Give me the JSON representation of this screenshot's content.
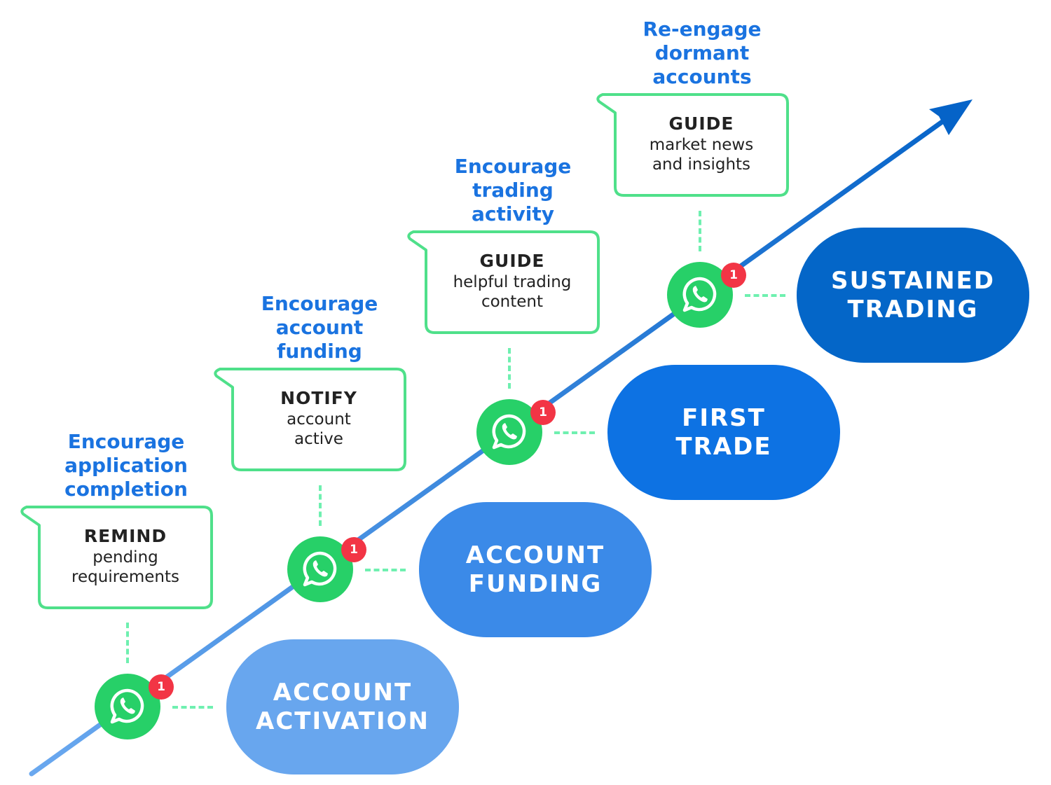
{
  "colors": {
    "goal_text": "#1a73e0",
    "bubble_border": "#4fe08a",
    "connector": "#6ff0b0",
    "whatsapp_green": "#27d068",
    "badge_red": "#f23545",
    "arrow_start": "#6aa8ef",
    "arrow_end": "#0563c8"
  },
  "steps": [
    {
      "goal": [
        "Encourage",
        "application",
        "completion"
      ],
      "action": "REMIND",
      "detail": [
        "pending",
        "requirements"
      ],
      "icon": "whatsapp-icon",
      "badge": "1",
      "stage": [
        "ACCOUNT",
        "ACTIVATION"
      ],
      "stage_color": "#68a6ee"
    },
    {
      "goal": [
        "Encourage",
        "account",
        "funding"
      ],
      "action": "NOTIFY",
      "detail": [
        "account",
        "active"
      ],
      "icon": "whatsapp-icon",
      "badge": "1",
      "stage": [
        "ACCOUNT",
        "FUNDING"
      ],
      "stage_color": "#3b8ae8"
    },
    {
      "goal": [
        "Encourage",
        "trading",
        "activity"
      ],
      "action": "GUIDE",
      "detail": [
        "helpful trading",
        "content"
      ],
      "icon": "whatsapp-icon",
      "badge": "1",
      "stage": [
        "FIRST",
        "TRADE"
      ],
      "stage_color": "#0d72e3"
    },
    {
      "goal": [
        "Re-engage",
        "dormant",
        "accounts"
      ],
      "action": "GUIDE",
      "detail": [
        "market news",
        "and insights"
      ],
      "icon": "whatsapp-icon",
      "badge": "1",
      "stage": [
        "SUSTAINED",
        "TRADING"
      ],
      "stage_color": "#0466c8"
    }
  ]
}
